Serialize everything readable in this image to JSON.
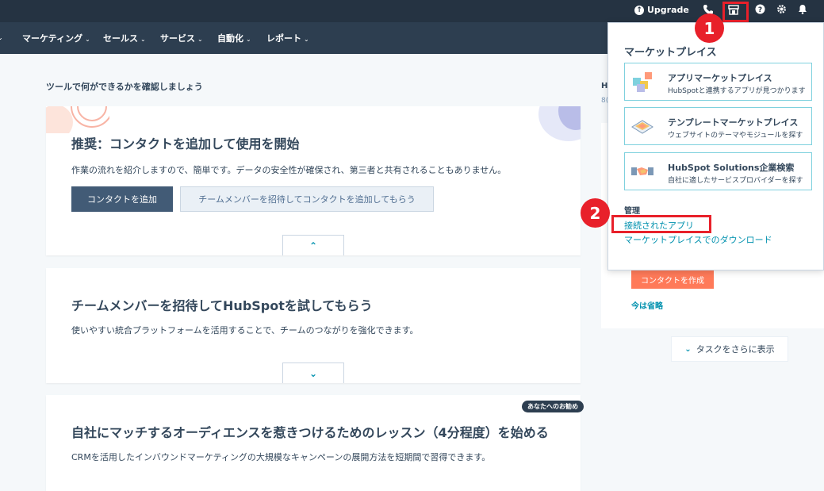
{
  "topbar": {
    "upgrade_label": "Upgrade",
    "icons": [
      "upgrade-icon",
      "phone-icon",
      "marketplace-icon",
      "help-icon",
      "settings-icon",
      "notifications-icon"
    ]
  },
  "nav": {
    "items": [
      {
        "label": "マーケティング"
      },
      {
        "label": "セールス"
      },
      {
        "label": "サービス"
      },
      {
        "label": "自動化"
      },
      {
        "label": "レポート"
      }
    ]
  },
  "main": {
    "intro_title": "ツールで何ができるかを確認しましょう",
    "cards": [
      {
        "title": "推奨：コンタクトを追加して使用を開始",
        "description": "作業の流れを紹介しますので、簡単です。データの安全性が確保され、第三者と共有されることもありません。",
        "primary_button": "コンタクトを追加",
        "secondary_button": "チームメンバーを招待してコンタクトを追加してもらう"
      },
      {
        "title": "チームメンバーを招待してHubSpotを試してもらう",
        "description": "使いやすい統合プラットフォームを活用することで、チームのつながりを強化できます。"
      },
      {
        "title": "自社にマッチするオーディエンスを惹きつけるためのレッスン（4分程度）を始める",
        "description": "CRMを活用したインバウンドマーケティングの大規模なキャンペーンの展開方法を短期間で習得できます。",
        "badge": "あなたへのお勧め"
      }
    ]
  },
  "right": {
    "tip_title": "H",
    "tip_sub": "8(",
    "create_contact": "コンタクトを作成",
    "skip": "今は省略",
    "more_tasks": "タスクをさらに表示"
  },
  "popup": {
    "title": "マーケットプレイス",
    "items": [
      {
        "title": "アプリマーケットプレイス",
        "subtitle": "HubSpotと連携するアプリが見つかります"
      },
      {
        "title": "テンプレートマーケットプレイス",
        "subtitle": "ウェブサイトのテーマやモジュールを探す"
      },
      {
        "title": "HubSpot Solutions企業検索",
        "subtitle": "自社に適したサービスプロバイダーを探す"
      }
    ],
    "manage_label": "管理",
    "links": [
      "接続されたアプリ",
      "マーケットプレイスでのダウンロード"
    ]
  },
  "steps": [
    "1",
    "2"
  ],
  "colors": {
    "topbar": "#253342",
    "navbar": "#2d3e50",
    "accent_link": "#0091ae",
    "primary_button": "#425b76",
    "orange": "#ff7a59",
    "annotation_red": "#e8202a"
  }
}
